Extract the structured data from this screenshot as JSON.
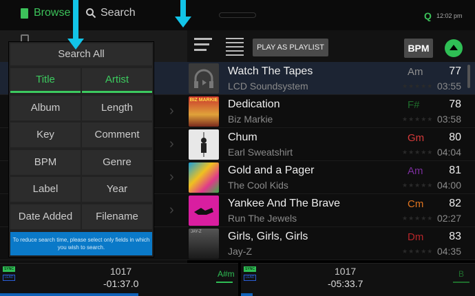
{
  "header": {
    "browse_label": "Browse",
    "search_label": "Search",
    "q_label": "Q",
    "clock": "12:02 pm",
    "icons": [
      "document-icon",
      "magnifier-icon",
      "q-icon"
    ]
  },
  "toolbar": {
    "play_label": "PLAY AS PLAYLIST",
    "bpm_label": "BPM"
  },
  "search_panel": {
    "search_all_label": "Search All",
    "fields": [
      {
        "label": "Title",
        "active": true
      },
      {
        "label": "Artist",
        "active": true
      },
      {
        "label": "Album",
        "active": false
      },
      {
        "label": "Length",
        "active": false
      },
      {
        "label": "Key",
        "active": false
      },
      {
        "label": "Comment",
        "active": false
      },
      {
        "label": "BPM",
        "active": false
      },
      {
        "label": "Genre",
        "active": false
      },
      {
        "label": "Label",
        "active": false
      },
      {
        "label": "Year",
        "active": false
      },
      {
        "label": "Date Added",
        "active": false
      },
      {
        "label": "Filename",
        "active": false
      }
    ],
    "note": "To reduce search time, please select only fields in which you wish to search."
  },
  "tracks": [
    {
      "title": "Watch The Tapes",
      "artist": "LCD Soundsystem",
      "key": "Am",
      "key_color": "#8e8e8e",
      "bpm": "77",
      "length": "03:55",
      "selected": true
    },
    {
      "title": "Dedication",
      "artist": "Biz Markie",
      "key": "F#",
      "key_color": "#1f6d2c",
      "bpm": "78",
      "length": "03:58",
      "selected": false,
      "art_text": "BIZ MARKIE"
    },
    {
      "title": "Chum",
      "artist": "Earl Sweatshirt",
      "key": "Gm",
      "key_color": "#d63a3a",
      "bpm": "80",
      "length": "04:04",
      "selected": false
    },
    {
      "title": "Gold and a Pager",
      "artist": "The Cool Kids",
      "key": "Am",
      "key_color": "#7a2e9c",
      "bpm": "81",
      "length": "04:00",
      "selected": false
    },
    {
      "title": "Yankee And The Brave",
      "artist": "Run The Jewels",
      "key": "Cm",
      "key_color": "#e0741f",
      "bpm": "82",
      "length": "02:27",
      "selected": false
    },
    {
      "title": "Girls, Girls, Girls",
      "artist": "Jay-Z",
      "key": "Dm",
      "key_color": "#b7262a",
      "bpm": "83",
      "length": "04:35",
      "selected": false,
      "art_text": "JAY-Z"
    }
  ],
  "decks": [
    {
      "sync": "SYNC",
      "lead": "LEAD",
      "bpm": "1017",
      "time": "-01:37.0",
      "key": "A#m",
      "key_color": "#2fbf55",
      "progress": 0.58
    },
    {
      "sync": "SYNC",
      "lead": "LEAD",
      "bpm": "1017",
      "time": "-05:33.7",
      "key": "B",
      "key_color": "#1f6d2c",
      "progress": 0.05
    }
  ]
}
